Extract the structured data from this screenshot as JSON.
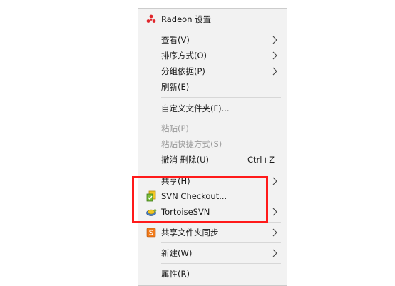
{
  "menu": {
    "radeon_label": "Radeon 设置",
    "view_label": "查看(V)",
    "sort_label": "排序方式(O)",
    "group_label": "分组依据(P)",
    "refresh_label": "刷新(E)",
    "customize_label": "自定义文件夹(F)...",
    "paste_label": "粘贴(P)",
    "paste_shortcut_label": "粘贴快捷方式(S)",
    "undo_label": "撤消 删除(U)",
    "undo_shortcut": "Ctrl+Z",
    "share_label": "共享(H)",
    "svn_checkout_label": "SVN Checkout...",
    "tortoise_label": "TortoiseSVN",
    "share_sync_label": "共享文件夹同步",
    "new_label": "新建(W)",
    "properties_label": "属性(R)"
  },
  "colors": {
    "menu_background": "#f2f2f2",
    "highlight_border": "#ff1a1a",
    "disabled_text": "#9b9b9b",
    "radeon_red": "#e0262b"
  },
  "icons": {
    "radeon": "radeon-logo-icon",
    "svn_checkout": "svn-checkout-icon",
    "tortoise": "tortoisesvn-icon",
    "share_sync": "share-sync-icon",
    "submenu": "chevron-right-icon"
  }
}
